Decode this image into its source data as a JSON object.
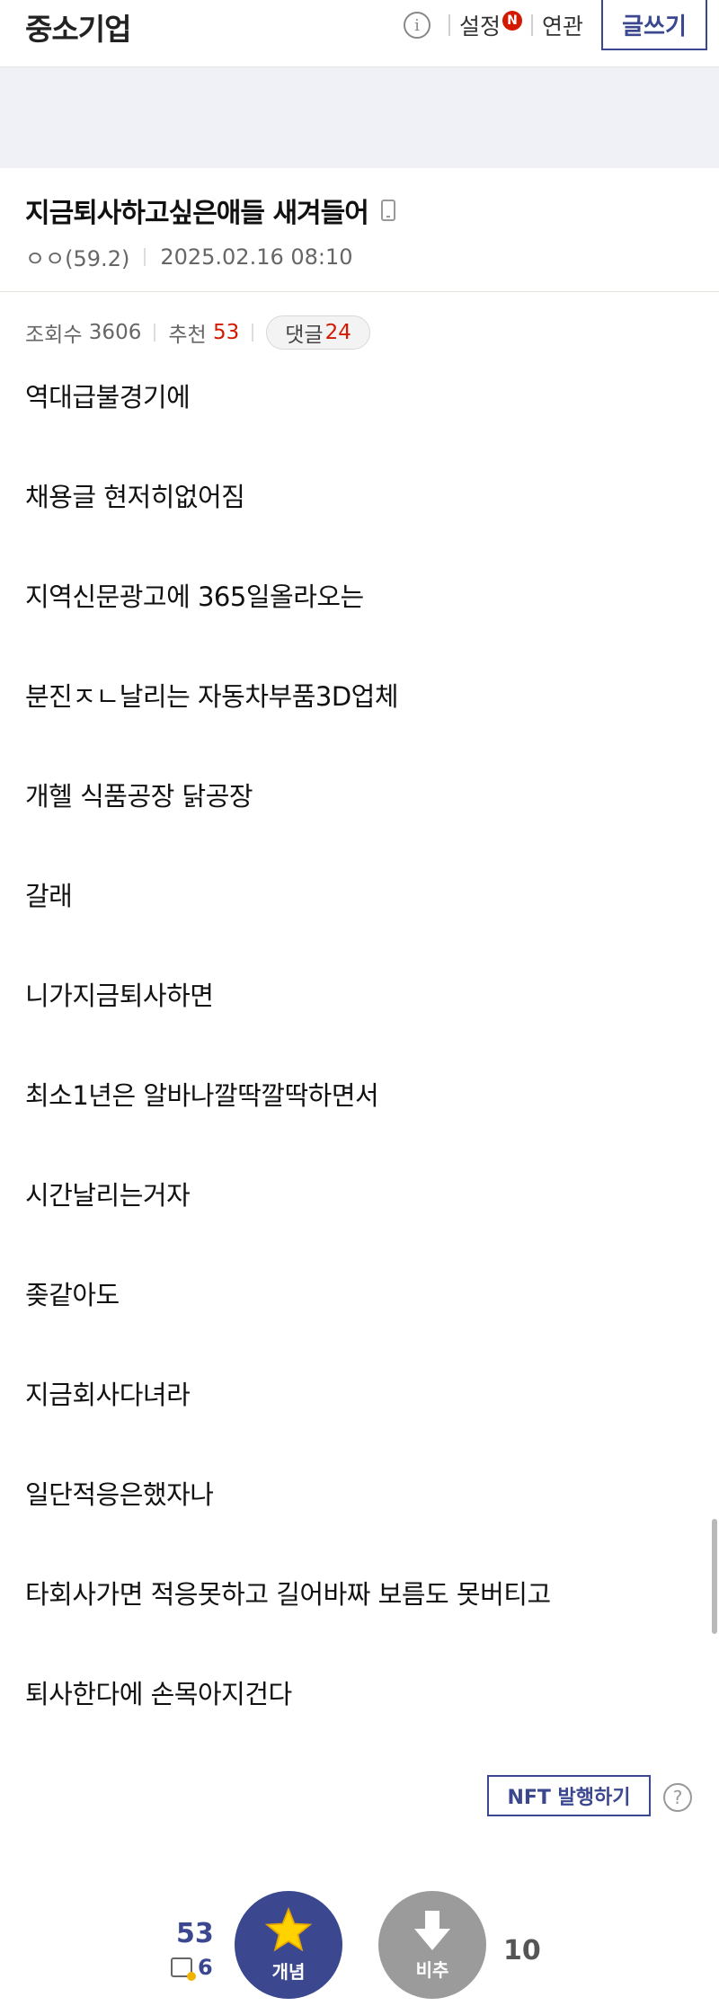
{
  "header": {
    "gallery_name": "중소기업",
    "info_symbol": "i",
    "settings_label": "설정",
    "new_badge": "N",
    "related_label": "연관",
    "write_label": "글쓰기"
  },
  "post": {
    "title": "지금퇴사하고싶은애들 새겨들어",
    "author": "ㅇㅇ(59.2)",
    "datetime": "2025.02.16 08:10",
    "views_label": "조회수",
    "views": "3606",
    "recommend_label": "추천",
    "recommend": "53",
    "comments_label": "댓글",
    "comments": "24",
    "body_lines": [
      "역대급불경기에",
      "채용글 현저히없어짐",
      "지역신문광고에 365일올라오는",
      "분진ㅈㄴ날리는 자동차부품3D업체",
      "개헬 식품공장 닭공장",
      "갈래",
      "니가지금퇴사하면",
      "최소1년은 알바나깔딱깔딱하면서",
      "시간날리는거자",
      "좆같아도",
      "지금회사다녀라",
      "일단적응은했자나",
      "타회사가면 적응못하고 길어바짜 보름도 못버티고",
      "퇴사한다에 손목아지건다"
    ]
  },
  "nft": {
    "label": "NFT 발행하기",
    "help_symbol": "?"
  },
  "vote": {
    "up_count": "53",
    "fix_count": "6",
    "up_label": "개념",
    "down_label": "비추",
    "down_count": "10"
  },
  "colors": {
    "brand": "#3b4890",
    "accent_red": "#d31900",
    "banner_bg": "#eff1f7"
  }
}
